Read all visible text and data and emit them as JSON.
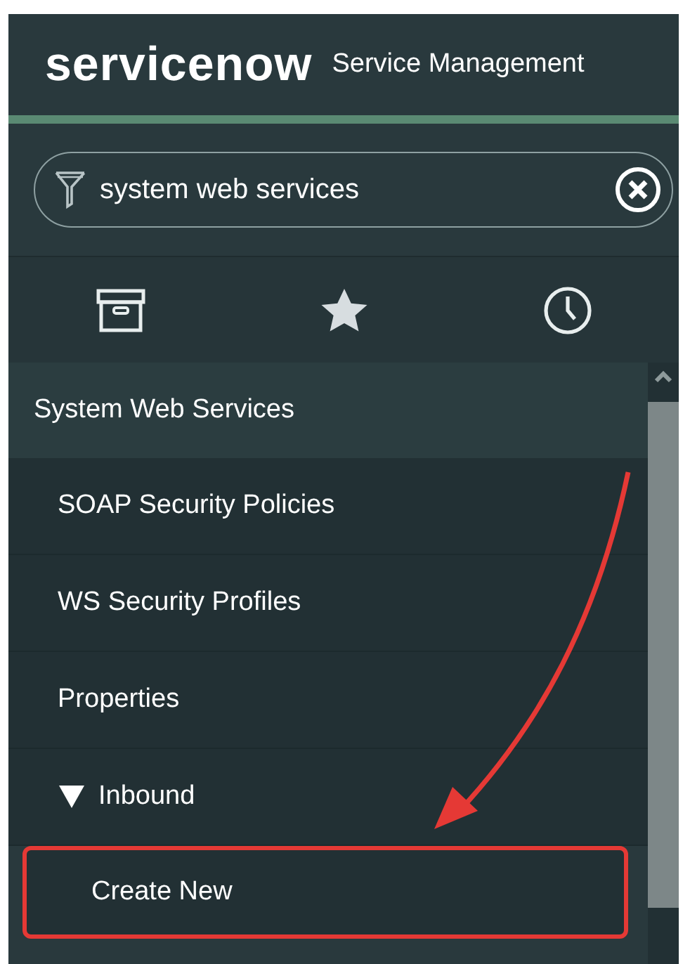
{
  "header": {
    "logo": "servicenow",
    "title": "Service Management"
  },
  "search": {
    "value": "system web services"
  },
  "navigator": {
    "application": {
      "label": "System Web Services",
      "children": [
        {
          "label": "SOAP Security Policies",
          "kind": "link",
          "highlighted": false
        },
        {
          "label": "WS Security Profiles",
          "kind": "link",
          "highlighted": false
        },
        {
          "label": "Properties",
          "kind": "link",
          "highlighted": false
        },
        {
          "label": "Inbound",
          "kind": "section",
          "expanded": true,
          "highlighted": false,
          "children": [
            {
              "label": "Create New",
              "kind": "link",
              "highlighted": true
            }
          ]
        }
      ]
    }
  }
}
